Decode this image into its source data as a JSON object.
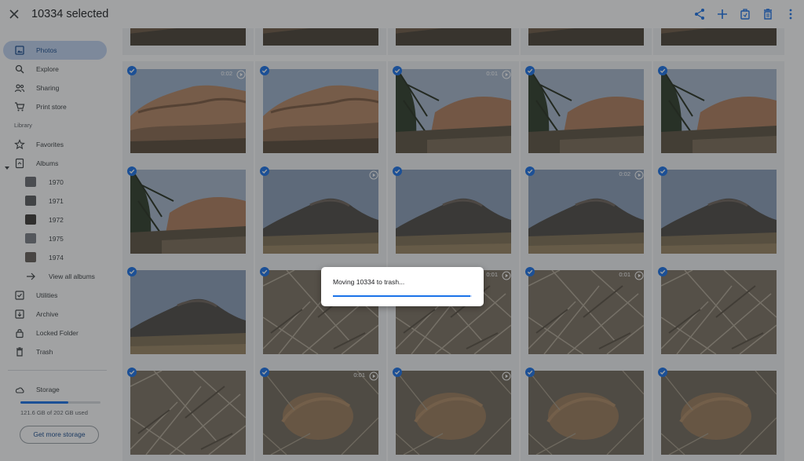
{
  "topbar": {
    "title": "10334 selected",
    "close_icon": "close-icon",
    "actions": [
      "share-icon",
      "add-icon",
      "add-to-album-icon",
      "trash-icon",
      "more-vert-icon"
    ]
  },
  "sidebar": {
    "items": [
      {
        "label": "Photos",
        "icon": "photo-icon",
        "active": true
      },
      {
        "label": "Explore",
        "icon": "search-icon"
      },
      {
        "label": "Sharing",
        "icon": "people-icon"
      },
      {
        "label": "Print store",
        "icon": "cart-icon"
      }
    ],
    "library_label": "Library",
    "library_items": [
      {
        "label": "Favorites",
        "icon": "star-icon"
      },
      {
        "label": "Albums",
        "icon": "album-icon"
      }
    ],
    "albums": [
      {
        "label": "1970"
      },
      {
        "label": "1971"
      },
      {
        "label": "1972"
      },
      {
        "label": "1975"
      },
      {
        "label": "1974"
      }
    ],
    "view_all_label": "View all albums",
    "more_items": [
      {
        "label": "Utilities",
        "icon": "utilities-icon"
      },
      {
        "label": "Archive",
        "icon": "archive-icon"
      },
      {
        "label": "Locked Folder",
        "icon": "lock-icon"
      },
      {
        "label": "Trash",
        "icon": "trash-icon"
      }
    ],
    "storage": {
      "label": "Storage",
      "icon": "cloud-icon",
      "used_text": "121.6 GB of 202 GB used",
      "used_fraction": 0.6,
      "button_label": "Get more storage"
    }
  },
  "grid": {
    "rows": [
      [
        {
          "scene": "rock"
        },
        {
          "scene": "rock"
        },
        {
          "scene": "rock"
        },
        {
          "scene": "rock"
        },
        {
          "scene": "rock"
        }
      ],
      [
        {
          "scene": "boulder",
          "duration": "0:02"
        },
        {
          "scene": "boulder"
        },
        {
          "scene": "tree",
          "duration": "0:01"
        },
        {
          "scene": "tree"
        },
        {
          "scene": "tree"
        }
      ],
      [
        {
          "scene": "tree"
        },
        {
          "scene": "hill",
          "duration": ""
        },
        {
          "scene": "hill"
        },
        {
          "scene": "hill",
          "duration": "0:02"
        },
        {
          "scene": "hill"
        }
      ],
      [
        {
          "scene": "hill"
        },
        {
          "scene": "brush"
        },
        {
          "scene": "brush",
          "duration": "0:01"
        },
        {
          "scene": "brush",
          "duration": "0:01"
        },
        {
          "scene": "brush"
        }
      ],
      [
        {
          "scene": "brush"
        },
        {
          "scene": "stone",
          "duration": "0:01"
        },
        {
          "scene": "stone",
          "duration": ""
        },
        {
          "scene": "stone"
        },
        {
          "scene": "stone"
        }
      ]
    ]
  },
  "dialog": {
    "text": "Moving 10334 to trash...",
    "progress": 0.99
  }
}
